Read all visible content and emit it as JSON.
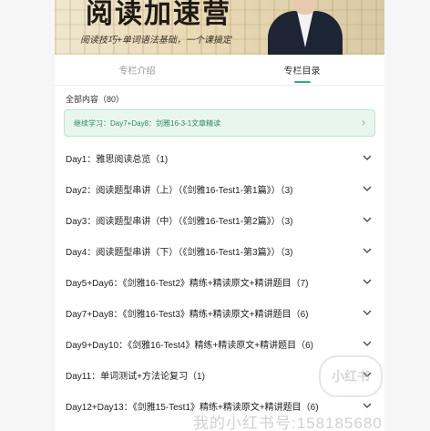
{
  "banner": {
    "title": "阅读加速营",
    "subtitle": "阅读技巧+单词语法基础，一个课搞定"
  },
  "tabs": [
    {
      "label": "专栏介绍"
    },
    {
      "label": "专栏目录"
    }
  ],
  "list": {
    "count_label": "全部内容（80）",
    "continue_label": "继续学习：Day7+Day8：剑雅16-3-1文章精读",
    "items": [
      {
        "label": "Day1：雅思阅读总览（1)"
      },
      {
        "label": "Day2：阅读题型串讲（上）（《剑雅16-Test1-第1篇》）（3)"
      },
      {
        "label": "Day3：阅读题型串讲（中）（《剑雅16-Test1-第2篇》）（3)"
      },
      {
        "label": "Day4：阅读题型串讲（下）（《剑雅16-Test1-第3篇》）（3)"
      },
      {
        "label": "Day5+Day6：《剑雅16-Test2》精练+精读原文+精讲题目（7)"
      },
      {
        "label": "Day7+Day8：《剑雅16-Test3》精练+精读原文+精讲题目（6)"
      },
      {
        "label": "Day9+Day10：《剑雅16-Test4》精练+精读原文+精讲题目（6)"
      },
      {
        "label": "Day11：单词测试+方法论复习（1)"
      },
      {
        "label": "Day12+Day13：《剑雅15-Test1》精练+精读原文+精讲题目（6)"
      }
    ]
  },
  "watermark": {
    "logo": "小红书",
    "text": "我的小红书号:158185680"
  },
  "colors": {
    "accent": "#2fb07a",
    "continue_bg": "#e9f6ef"
  }
}
